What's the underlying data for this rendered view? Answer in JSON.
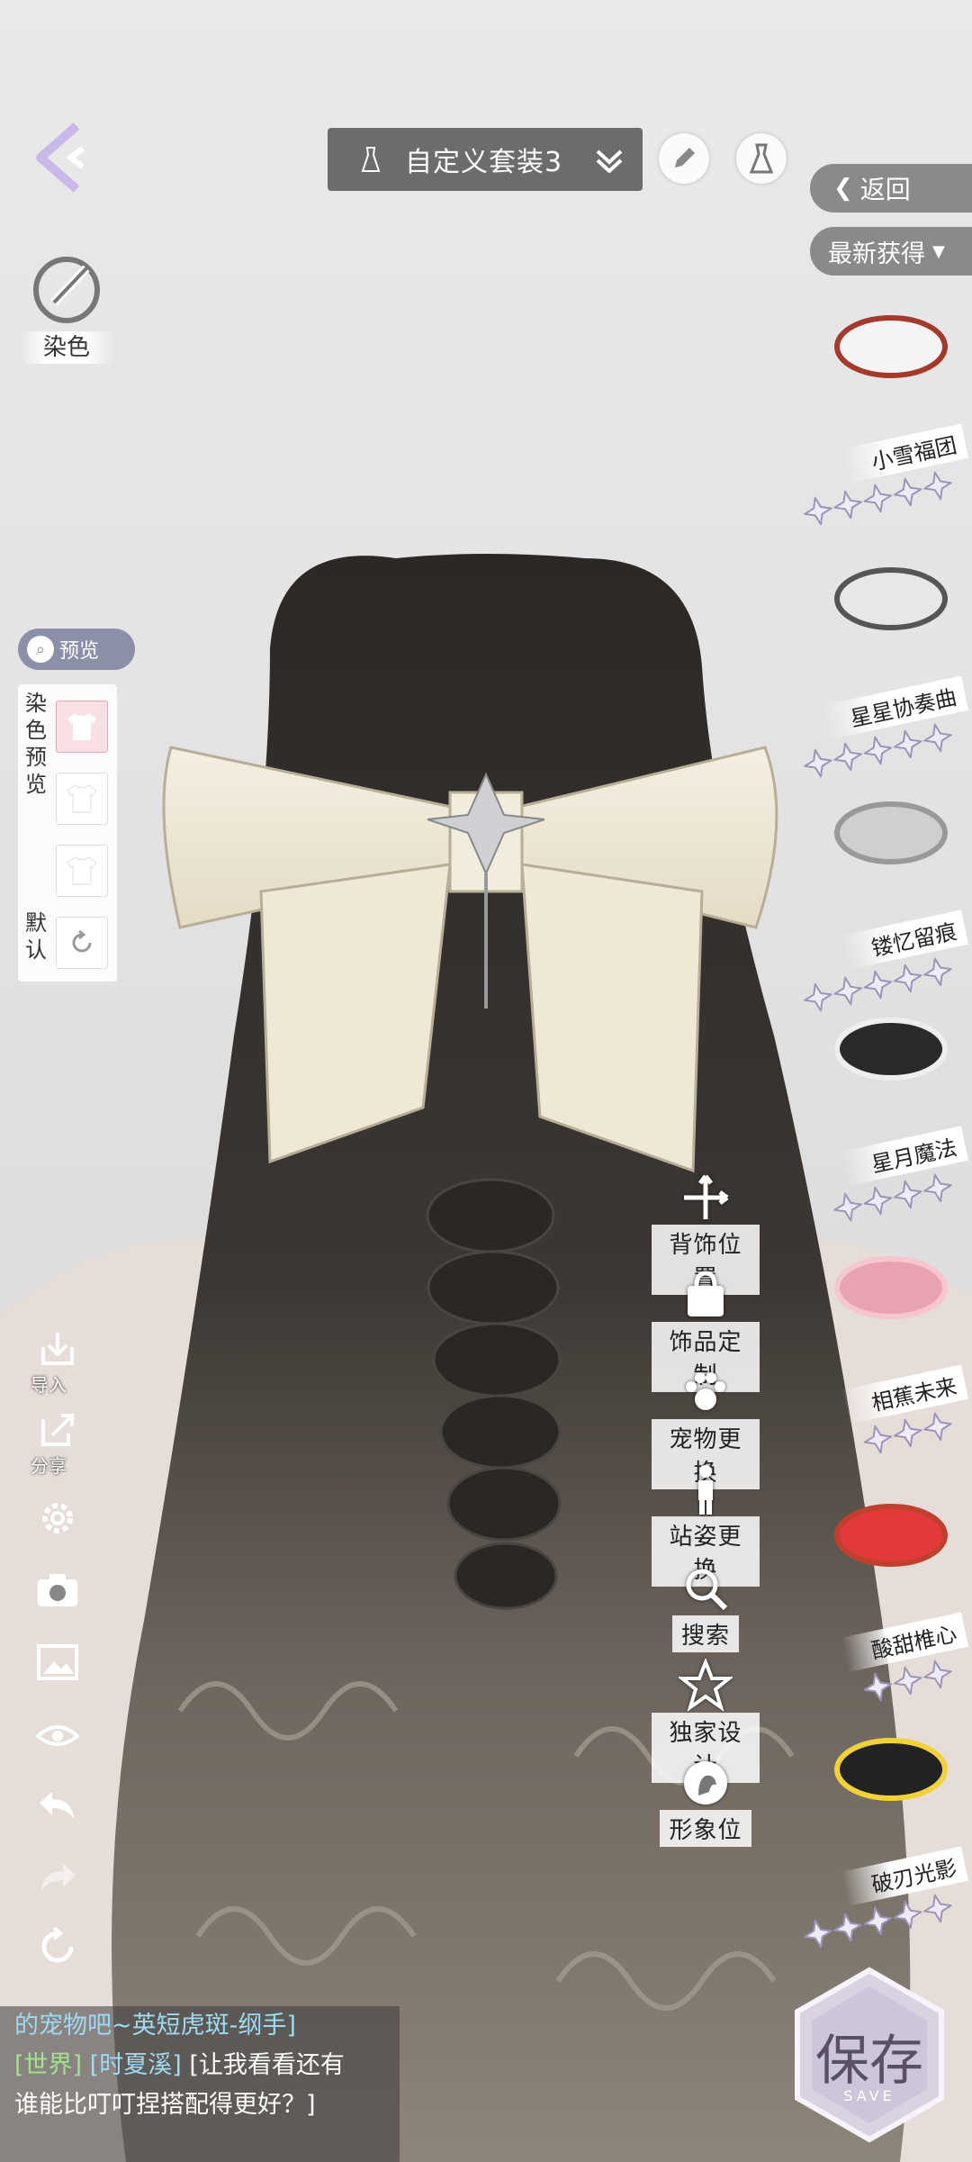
{
  "header": {
    "outfit_name": "自定义套装3"
  },
  "left_panel": {
    "dye_label": "染色",
    "preview_label": "预览",
    "dye_preview_label": "染色预览",
    "default_label": "默认",
    "import_label": "导入",
    "share_label": "分享"
  },
  "right_panel": {
    "return_label": "返回",
    "sort_label": "最新获得",
    "items": [
      {
        "name": "小雪福团",
        "stars": 5
      },
      {
        "name": "星星协奏曲",
        "stars": 5
      },
      {
        "name": "镂忆留痕",
        "stars": 5
      },
      {
        "name": "星月魔法",
        "stars": 4
      },
      {
        "name": "相蕉未来",
        "stars": 3
      },
      {
        "name": "酸甜椎心",
        "stars": 3
      },
      {
        "name": "破刃光影",
        "stars": 5
      }
    ]
  },
  "functions": [
    {
      "label": "背饰位置",
      "icon": "move-arrows-icon"
    },
    {
      "label": "饰品定制",
      "icon": "bag-icon"
    },
    {
      "label": "宠物更换",
      "icon": "paw-icon"
    },
    {
      "label": "站姿更换",
      "icon": "person-icon"
    },
    {
      "label": "搜索",
      "icon": "search-icon"
    },
    {
      "label": "独家设计",
      "icon": "star-icon"
    },
    {
      "label": "形象位",
      "icon": "profile-icon"
    }
  ],
  "chat": {
    "line1": "的宠物吧~英短虎斑-纲手]",
    "tag": "[世界]",
    "name": "[时夏溪]",
    "msg_a": "[让我看看还有",
    "msg_b": "谁能比叮叮捏搭配得更好？]"
  },
  "save": {
    "label": "保存",
    "sub": "SAVE"
  }
}
